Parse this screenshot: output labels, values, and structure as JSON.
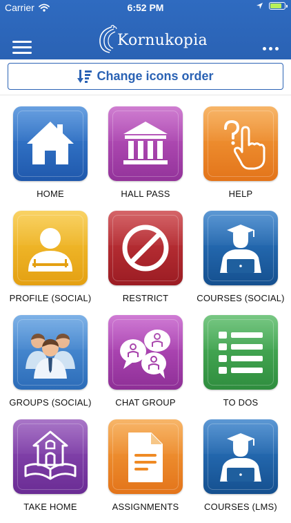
{
  "status_bar": {
    "carrier": "Carrier",
    "time": "6:52 PM"
  },
  "header": {
    "logo_text": "Kornukopia",
    "menu_icon": "hamburger-icon",
    "more_icon": "more-dots-icon"
  },
  "toolbar": {
    "reorder_label": "Change icons order",
    "reorder_icon": "sort-icon"
  },
  "tiles": [
    {
      "label": "HOME",
      "icon": "home-icon",
      "color": "#2e6ec6"
    },
    {
      "label": "HALL PASS",
      "icon": "hall-pass-icon",
      "color": "#a543a6"
    },
    {
      "label": "HELP",
      "icon": "help-icon",
      "color": "#ef8a24"
    },
    {
      "label": "PROFILE (SOCIAL)",
      "icon": "profile-icon",
      "color": "#f0b21e"
    },
    {
      "label": "RESTRICT",
      "icon": "restrict-icon",
      "color": "#b0252c"
    },
    {
      "label": "COURSES (SOCIAL)",
      "icon": "graduate-icon",
      "color": "#1e5fa5"
    },
    {
      "label": "GROUPS (SOCIAL)",
      "icon": "groups-icon",
      "color": "#3f83cf"
    },
    {
      "label": "CHAT GROUP",
      "icon": "chat-group-icon",
      "color": "#a43ca8"
    },
    {
      "label": "TO DOS",
      "icon": "todo-list-icon",
      "color": "#3aa04b"
    },
    {
      "label": "TAKE HOME",
      "icon": "take-home-icon",
      "color": "#7a3aa2"
    },
    {
      "label": "ASSIGNMENTS",
      "icon": "assignment-icon",
      "color": "#ef8a24"
    },
    {
      "label": "COURSES (LMS)",
      "icon": "graduate-icon",
      "color": "#1e5fa5"
    }
  ]
}
